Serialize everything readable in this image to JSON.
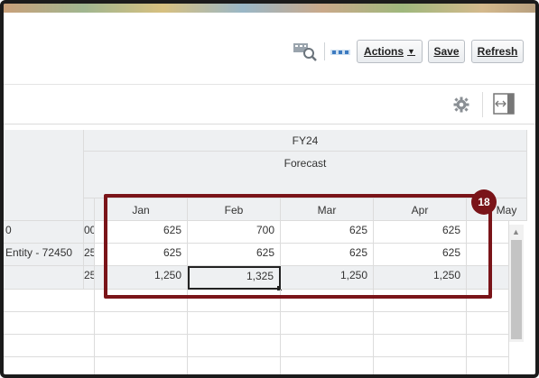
{
  "toolbar": {
    "actions_label": "Actions",
    "save_label": "Save",
    "refresh_label": "Refresh"
  },
  "grid": {
    "year": "FY24",
    "scenario": "Forecast",
    "columns": [
      "Jan",
      "Feb",
      "Mar",
      "Apr",
      "May"
    ],
    "rows": [
      {
        "label": "0",
        "partial": "00",
        "values": [
          "625",
          "700",
          "625",
          "625"
        ]
      },
      {
        "label": "Entity - 72450",
        "partial": "25",
        "values": [
          "625",
          "625",
          "625",
          "625"
        ]
      },
      {
        "label": "",
        "partial": "25",
        "values": [
          "1,250",
          "1,325",
          "1,250",
          "1,250"
        ]
      }
    ]
  },
  "callout": {
    "number": "18",
    "color": "#7a1419"
  }
}
